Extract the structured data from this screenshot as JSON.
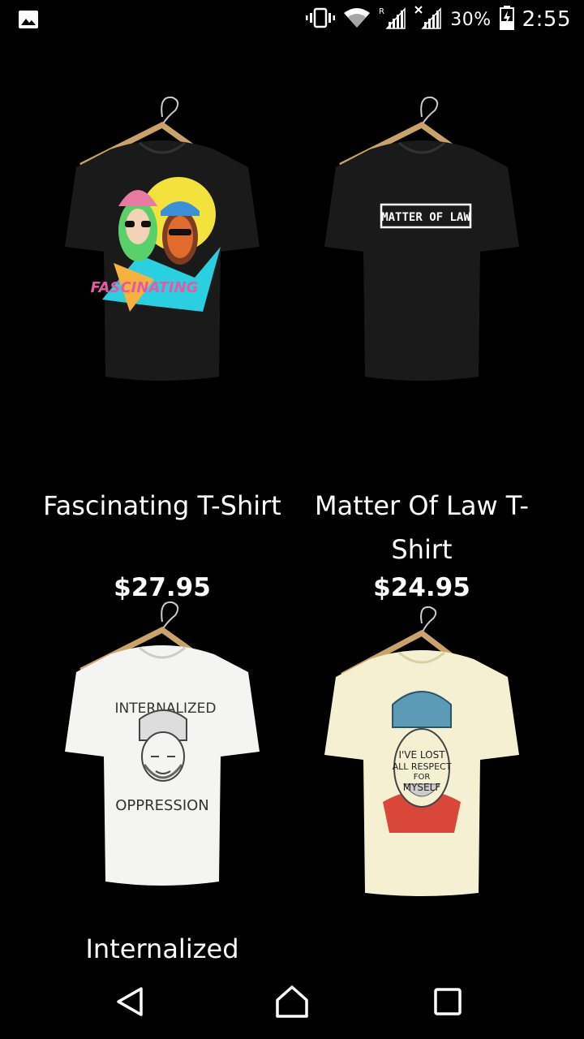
{
  "status_bar": {
    "left_icon": "image-icon",
    "icons": [
      "vibrate-icon",
      "wifi-icon",
      "signal-r-icon",
      "signal-x-icon",
      "battery-icon"
    ],
    "battery_percent": "30%",
    "time": "2:55"
  },
  "products": [
    {
      "name": "Fascinating T-Shirt",
      "price": "$27.95",
      "shirt_color": "#1a1a1a",
      "print_text": "FASCINATING"
    },
    {
      "name": "Matter Of Law T-Shirt",
      "price": "$24.95",
      "shirt_color": "#1a1a1a",
      "print_text": "MATTER OF LAW"
    },
    {
      "name": "Internalized",
      "price": "",
      "shirt_color": "#f4f4f2",
      "print_text_top": "INTERNALIZED",
      "print_text_bottom": "OPPRESSION"
    },
    {
      "name": "",
      "price": "",
      "shirt_color": "#f6f0d2",
      "print_text": "I'VE LOST ALL RESPECT FOR MYSELF"
    }
  ],
  "nav_bar": {
    "buttons": [
      "back-icon",
      "home-icon",
      "recent-apps-icon"
    ]
  }
}
